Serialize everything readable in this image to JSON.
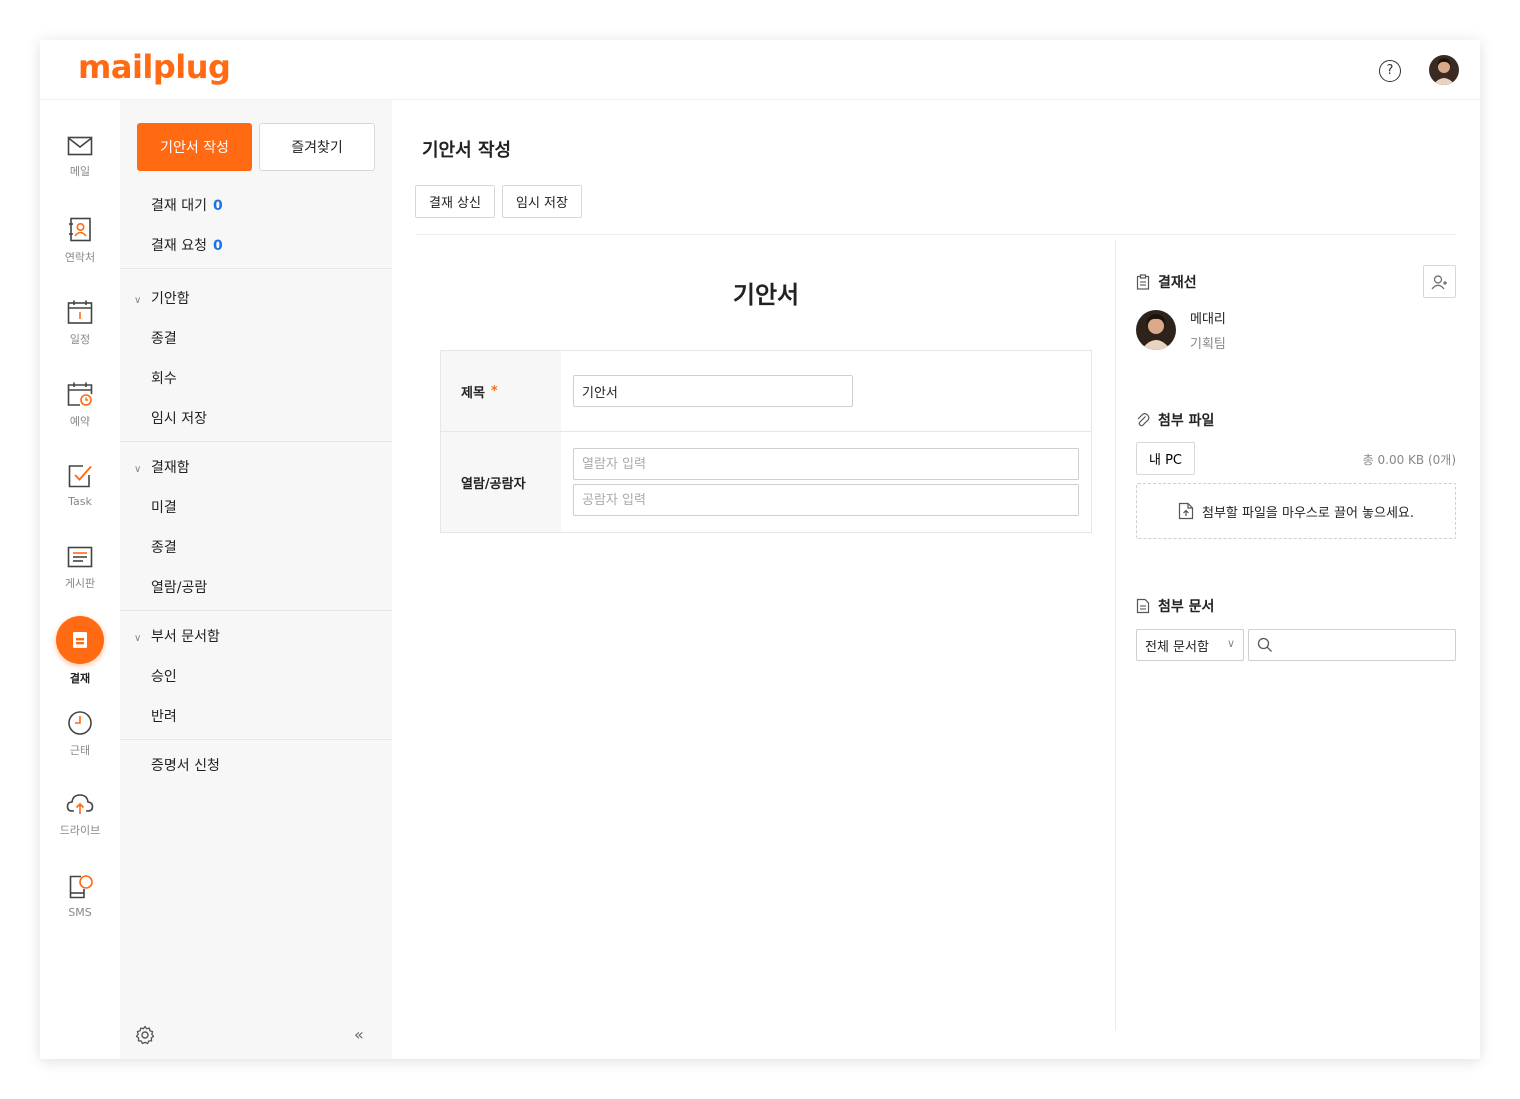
{
  "brand": {
    "logo_text": "mailplug",
    "accent": "#ff6a13",
    "link_blue": "#1a73e8"
  },
  "topbar": {
    "help_icon": "help-icon",
    "help_glyph": "?",
    "avatar_icon": "user-avatar"
  },
  "rail": {
    "items": [
      {
        "label": "메일",
        "icon": "mail-icon"
      },
      {
        "label": "연락처",
        "icon": "contacts-icon"
      },
      {
        "label": "일정",
        "icon": "calendar-icon"
      },
      {
        "label": "예약",
        "icon": "reservation-icon"
      },
      {
        "label": "Task",
        "icon": "task-icon"
      },
      {
        "label": "게시판",
        "icon": "board-icon"
      },
      {
        "label": "결재",
        "icon": "approval-icon",
        "active": true
      },
      {
        "label": "근태",
        "icon": "clock-icon"
      },
      {
        "label": "드라이브",
        "icon": "cloud-icon"
      },
      {
        "label": "SMS",
        "icon": "sms-icon"
      }
    ]
  },
  "menu": {
    "compose_label": "기안서 작성",
    "favorites_label": "즐겨찾기",
    "pending_label": "결재 대기",
    "pending_count": "0",
    "requested_label": "결재 요청",
    "requested_count": "0",
    "groups": [
      {
        "label": "기안함",
        "items": [
          "종결",
          "회수",
          "임시 저장"
        ]
      },
      {
        "label": "결재함",
        "items": [
          "미결",
          "종결",
          "열람/공람"
        ]
      },
      {
        "label": "부서 문서함",
        "items": [
          "승인",
          "반려"
        ]
      }
    ],
    "certificate_label": "증명서 신청",
    "chevron_glyph": "∨",
    "collapse_glyph": "«"
  },
  "content": {
    "page_title": "기안서 작성",
    "submit_label": "결재 상신",
    "save_draft_label": "임시 저장",
    "document_title": "기안서",
    "form": {
      "subject_label": "제목",
      "required_mark": "*",
      "subject_value": "기안서",
      "viewers_label": "열람/공람자",
      "viewer_placeholder": "열람자 입력",
      "circulation_placeholder": "공람자 입력"
    }
  },
  "side": {
    "approval_line_title": "결재선",
    "approver": {
      "name": "메대리",
      "team": "기획팀"
    },
    "attachments_title": "첨부 파일",
    "my_pc_label": "내 PC",
    "total_size": "총 0.00 KB (0개)",
    "dropzone_text": "첨부할 파일을 마우스로 끌어 놓으세요.",
    "attached_docs_title": "첨부 문서",
    "doc_filter_value": "전체 문서함",
    "caret_glyph": "∨",
    "doc_search_value": ""
  }
}
